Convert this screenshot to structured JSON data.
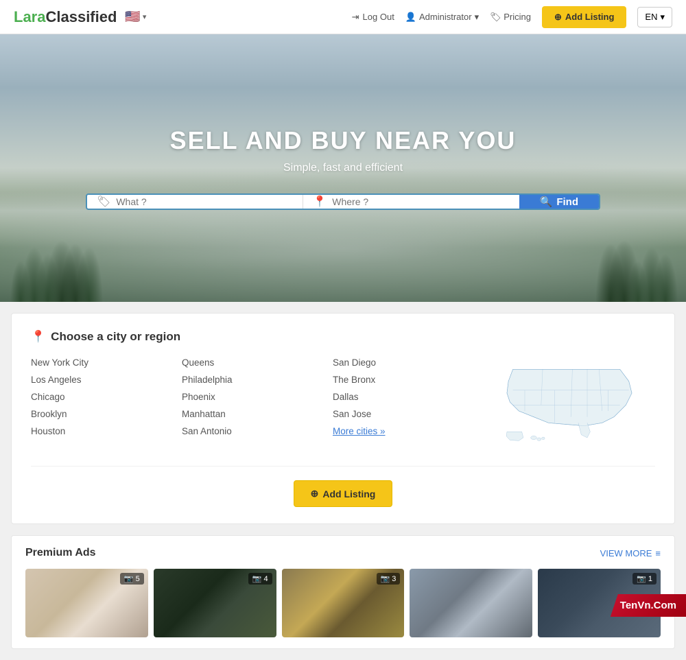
{
  "brand": {
    "lara": "Lara",
    "classified": "Classified"
  },
  "navbar": {
    "logout_label": "Log Out",
    "admin_label": "Administrator",
    "pricing_label": "Pricing",
    "add_listing_label": "Add Listing",
    "lang_label": "EN"
  },
  "hero": {
    "title": "SELL AND BUY NEAR YOU",
    "subtitle": "Simple, fast and efficient",
    "search_what_placeholder": "What ?",
    "search_where_placeholder": "Where ?",
    "find_label": "Find"
  },
  "cities": {
    "heading": "Choose a city or region",
    "col1": [
      "New York City",
      "Los Angeles",
      "Chicago",
      "Brooklyn",
      "Houston"
    ],
    "col2": [
      "Queens",
      "Philadelphia",
      "Phoenix",
      "Manhattan",
      "San Antonio"
    ],
    "col3": [
      "San Diego",
      "The Bronx",
      "Dallas",
      "San Jose",
      "More cities »"
    ],
    "add_listing_label": "Add Listing"
  },
  "premium": {
    "title_prefix": "Premium ",
    "title_bold": "Ads",
    "view_more_label": "VIEW MORE",
    "ads": [
      {
        "photo_count": "5",
        "img_class": "ad-img-living"
      },
      {
        "photo_count": "4",
        "img_class": "ad-img-moto"
      },
      {
        "photo_count": "3",
        "img_class": "ad-img-gameboy"
      },
      {
        "photo_count": "",
        "img_class": "ad-img-car"
      },
      {
        "photo_count": "1",
        "img_class": "ad-img-camera"
      }
    ]
  },
  "watermark": {
    "text": "TenVn.Com"
  },
  "icons": {
    "logout": "→",
    "user": "👤",
    "tag": "🏷",
    "plus": "+",
    "search": "🔍",
    "pin": "📍",
    "what_icon": "🏷",
    "where_icon": "📍",
    "camera": "📷",
    "menu_lines": "≡"
  }
}
